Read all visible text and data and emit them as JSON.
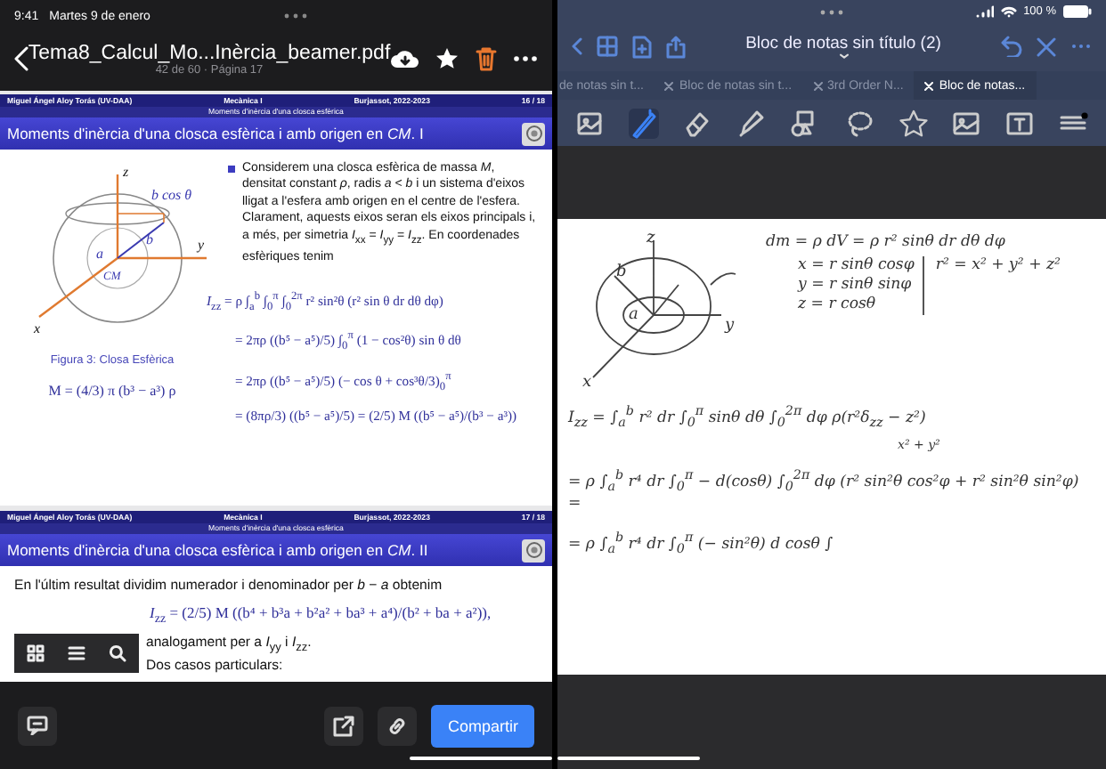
{
  "status_bar": {
    "time": "9:41",
    "date": "Martes 9 de enero",
    "battery": "100 %"
  },
  "pdf_viewer": {
    "title": "Tema8_Calcul_Mo...Inèrcia_beamer.pdf",
    "subtitle": "42 de 60 · Página 17",
    "slides": [
      {
        "kind": "figure",
        "author": "Miguel Ángel Aloy Torás (UV-DAA)",
        "course": "Mecànica I",
        "place": "Burjassot, 2022-2023",
        "page": "16 / 18",
        "section": "Moments d'inèrcia d'una closca esfèrica",
        "title": "Moments d'inèrcia d'una closca esfèrica i amb origen en *CM*. I",
        "figure_labels": {
          "z": "z",
          "y": "y",
          "x": "x",
          "bcos": "b cos θ",
          "a": "a",
          "b": "b",
          "cm": "CM"
        },
        "caption": "Figura 3: Closa Esfèrica",
        "mass": "M = (4/3) π (b³ − a³) ρ",
        "bullet": "Considerem una closca esfèrica de massa *M*, densitat constant *ρ*, radis *a* < *b* i un sistema d'eixos lligat a l'esfera amb origen en el centre de l'esfera. Clarament, aquests eixos seran els eixos principals i, a més, per simetria *I*$_{xx}$ = *I*$_{yy}$ = *I*$_{zz}$. En coordenades esfèriques tenim",
        "equations": [
          "*I*$_{zz}$ = ρ ∫$_{a}$$^{b}$ ∫$_{0}$$^{π}$ ∫$_{0}$$^{2π}$ r² sin²θ (r² sin θ dr dθ dφ)",
          "= 2πρ ((b⁵ − a⁵)/5) ∫$_{0}$$^{π}$ (1 − cos²θ) sin θ dθ",
          "= 2πρ ((b⁵ − a⁵)/5) (− cos θ + cos³θ/3)$_{0}$$^{π}$",
          "= (8πρ/3) ((b⁵ − a⁵)/5) = (2/5) M ((b⁵ − a⁵)/(b³ − a³))"
        ]
      },
      {
        "kind": "text",
        "author": "Miguel Ángel Aloy Torás (UV-DAA)",
        "course": "Mecànica I",
        "place": "Burjassot, 2022-2023",
        "page": "17 / 18",
        "section": "Moments d'inèrcia d'una closca esfèrica",
        "title": "Moments d'inèrcia d'una closca esfèrica i amb origen en *CM*. II",
        "intro": "En l'últim resultat dividim numerador i denominador per *b* − *a* obtenim",
        "equation": "*I*$_{zz}$ = (2/5) M ((b⁴ + b³a + b²a² + ba³ + a⁴)/(b² + ba + a²)),",
        "lines": [
          "analogament per a *I*$_{yy}$ i *I*$_{zz}$.",
          "Dos casos particulars:"
        ]
      }
    ],
    "share_button": "Compartir"
  },
  "notes": {
    "title": "Bloc de notas sin título (2)",
    "tabs": [
      {
        "label": "de notas sin t...",
        "selected": false
      },
      {
        "label": "Bloc de notas sin t...",
        "selected": false
      },
      {
        "label": "3rd Order N...",
        "selected": false
      },
      {
        "label": "Bloc de notas...",
        "selected": true
      }
    ],
    "tools": [
      {
        "kind": "scan",
        "selected": false
      },
      {
        "kind": "pen",
        "selected": true
      },
      {
        "kind": "eraser",
        "selected": false
      },
      {
        "kind": "highlighter",
        "selected": false
      },
      {
        "kind": "shapes",
        "selected": false
      },
      {
        "kind": "lasso",
        "selected": false
      },
      {
        "kind": "sticker",
        "selected": false
      },
      {
        "kind": "image",
        "selected": false
      },
      {
        "kind": "text",
        "selected": false
      },
      {
        "kind": "menu",
        "selected": false
      }
    ],
    "sketch_labels": {
      "z": "z",
      "y": "y",
      "x": "x",
      "a": "a",
      "b": "b"
    },
    "dm": "dm = ρ dV = ρ r² sinθ dr dθ dφ",
    "coords": [
      "x = r sinθ cosφ",
      "y = r sinθ sinφ",
      "z = r cosθ"
    ],
    "radius": "r² = x² + y² + z²",
    "izz": "I$_{zz}$ = ∫$_{a}$$^{b}$ r² dr ∫$_{0}$$^{π}$ sinθ dθ ∫$_{0}$$^{2π}$ dφ ρ(r²δ$_{zz}$ − z²)",
    "izz_note": "x² + y²",
    "steps": [
      "= ρ ∫$_{a}$$^{b}$ r⁴ dr ∫$_{0}$$^{π}$ − d(cosθ) ∫$_{0}$$^{2π}$ dφ (r² sin²θ cos²φ + r² sin²θ sin²φ) =",
      "= ρ ∫$_{a}$$^{b}$ r⁴ dr ∫$_{0}$$^{π}$ (− sin²θ) d cosθ ∫"
    ]
  }
}
